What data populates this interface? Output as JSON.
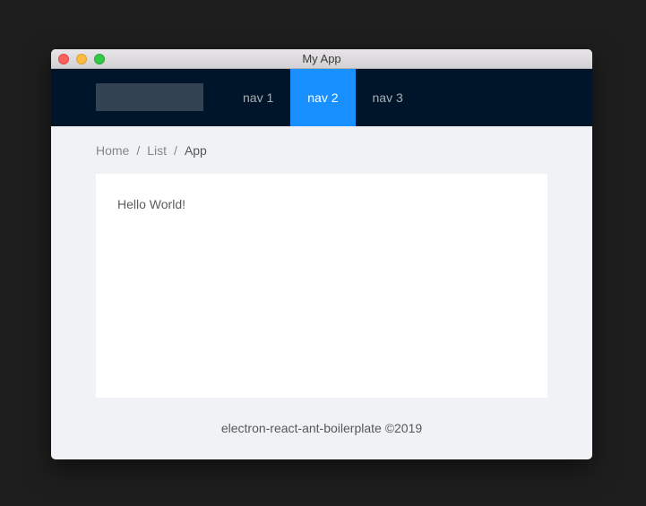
{
  "window": {
    "title": "My App"
  },
  "header": {
    "nav": [
      {
        "label": "nav 1",
        "active": false
      },
      {
        "label": "nav 2",
        "active": true
      },
      {
        "label": "nav 3",
        "active": false
      }
    ]
  },
  "breadcrumb": {
    "items": [
      "Home",
      "List",
      "App"
    ],
    "separator": "/"
  },
  "content": {
    "text": "Hello World!"
  },
  "footer": {
    "text": "electron-react-ant-boilerplate ©2019"
  },
  "colors": {
    "header_bg": "#001529",
    "accent": "#1890ff",
    "page_bg": "#f0f2f5"
  }
}
